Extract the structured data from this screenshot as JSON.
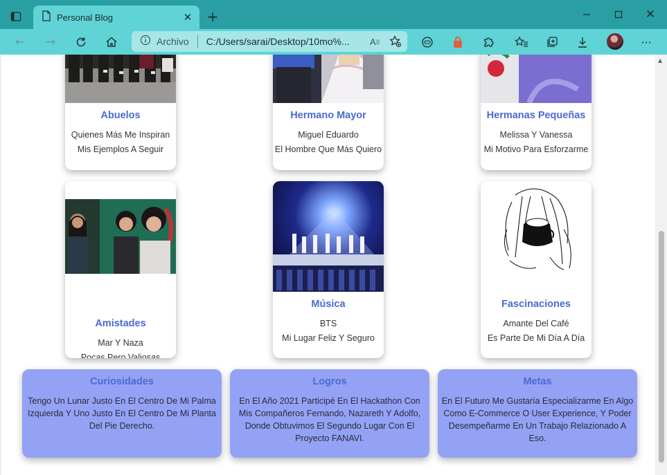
{
  "browser": {
    "tab_title": "Personal Blog",
    "address_label": "Archivo",
    "address_url": "C:/Users/sarai/Desktop/10mo%..."
  },
  "cards": [
    {
      "title": "Abuelos",
      "line1": "Quienes Más Me Inspiran",
      "line2": "Mis Ejemplos A Seguir"
    },
    {
      "title": "Hermano Mayor",
      "line1": "Miguel Eduardo",
      "line2": "El Hombre Que Más Quiero"
    },
    {
      "title": "Hermanas Pequeñas",
      "line1": "Melissa Y Vanessa",
      "line2": "Mi Motivo Para Esforzarme"
    },
    {
      "title": "Amistades",
      "line1": "Mar Y Naza",
      "line2": "Pocas Pero Valiosas"
    },
    {
      "title": "Música",
      "line1": "BTS",
      "line2": "Mi Lugar Feliz Y Seguro"
    },
    {
      "title": "Fascinaciones",
      "line1": "Amante Del Café",
      "line2": "Es Parte De Mi Día A Día"
    }
  ],
  "info": [
    {
      "title": "Curiosidades",
      "text": "Tengo Un Lunar Justo En El Centro De Mi Palma Izquierda Y Uno Justo En El Centro De Mi Planta Del Pie Derecho."
    },
    {
      "title": "Logros",
      "text": "En El Año 2021 Participé En El Hackathon Con Mis Compañeros Fernando, Nazareth Y Adolfo, Donde Obtuvimos El Segundo Lugar Con El Proyecto FANAVI."
    },
    {
      "title": "Metas",
      "text": "En El Futuro Me Gustaría Especializarme En Algo Como E-Commerce O User Experience, Y Poder Desempeñarme En Un Trabajo Relazionado A Eso."
    }
  ],
  "colors": {
    "chrome_dark": "#2a9fa3",
    "chrome_light": "#5fd3d6",
    "card_title": "#4a6ad0",
    "info_bg": "#94a2f6"
  }
}
